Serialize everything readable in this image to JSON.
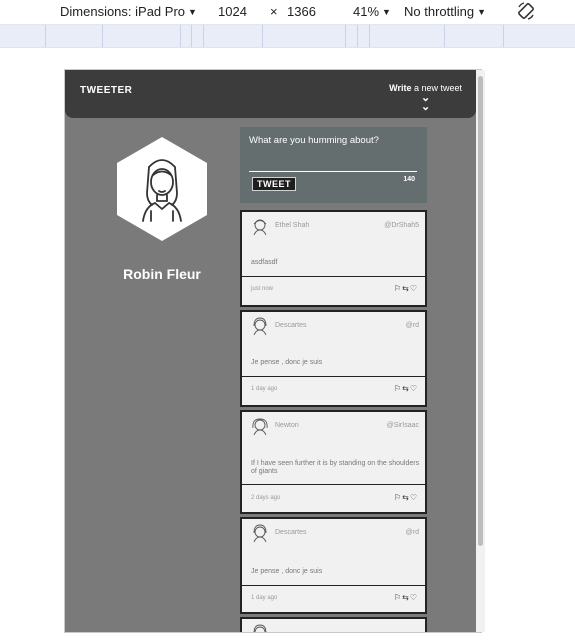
{
  "devtools": {
    "dimensions_label": "Dimensions: iPad Pro",
    "width": "1024",
    "times": "×",
    "height": "1366",
    "zoom": "41%",
    "throttling": "No throttling"
  },
  "app": {
    "brand": "TWEETER",
    "write_bold": "Write",
    "write_rest": " a new tweet",
    "chevron": "❯❯"
  },
  "profile": {
    "name": "Robin Fleur"
  },
  "compose": {
    "placeholder": "What are you humming about?",
    "button_label": "TWEET",
    "char_count": "140"
  },
  "tweets": [
    {
      "author": "Ethel Shah",
      "handle": "@DrShah5",
      "text": "asdfasdf",
      "time": "just now"
    },
    {
      "author": "Descartes",
      "handle": "@rd",
      "text": "Je pense , donc je suis",
      "time": "1 day ago"
    },
    {
      "author": "Newton",
      "handle": "@SirIsaac",
      "text": "If I have seen further it is by standing on the shoulders of giants",
      "time": "2 days ago"
    },
    {
      "author": "Descartes",
      "handle": "@rd",
      "text": "Je pense , donc je suis",
      "time": "1 day ago"
    }
  ]
}
